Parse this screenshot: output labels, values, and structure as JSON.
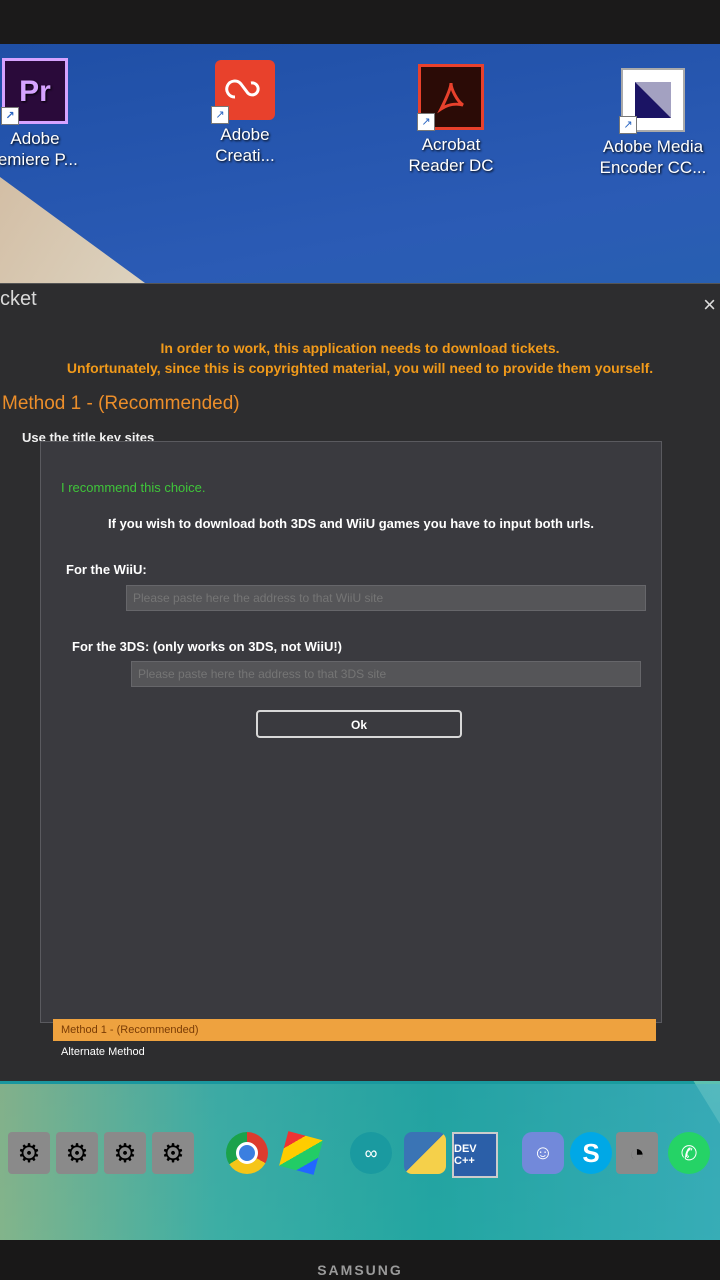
{
  "desktop": {
    "icons": [
      {
        "label_line1": "Adobe",
        "label_line2": "remiere P...",
        "tile": "Pr"
      },
      {
        "label_line1": "Adobe",
        "label_line2": "Creati..."
      },
      {
        "label_line1": "Acrobat",
        "label_line2": "Reader DC"
      },
      {
        "label_line1": "Adobe Media",
        "label_line2": "Encoder CC..."
      }
    ]
  },
  "window": {
    "title": "cket",
    "close_icon": "×",
    "warning_line1": "In order to work, this application needs to download tickets.",
    "warning_line2": "Unfortunately, since this is copyrighted material, you will need to provide them yourself.",
    "method_title": "Method 1 - (Recommended)",
    "group_label": "Use the title key sites",
    "recommend_text": "I recommend this choice.",
    "info_text": "If you wish to download both 3DS and WiiU games you have to input both urls.",
    "wiiu_label": "For the WiiU:",
    "wiiu_placeholder": "Please paste here the address to that WiiU site",
    "ds_label": "For the 3DS: (only works on 3DS, not WiiU!)",
    "ds_placeholder": "Please paste here the address to that 3DS site",
    "ok_button": "Ok",
    "tabs": [
      {
        "label": "Method 1 - (Recommended)",
        "active": true
      },
      {
        "label": "Alternate Method",
        "active": false
      }
    ]
  },
  "taskbar": {
    "dev_label": "DEV C++",
    "skype_label": "S"
  },
  "monitor": {
    "brand": "SAMSUNG"
  },
  "colors": {
    "accent": "#f19a1a",
    "green": "#3fc53a",
    "tab_active": "#eea23f"
  }
}
